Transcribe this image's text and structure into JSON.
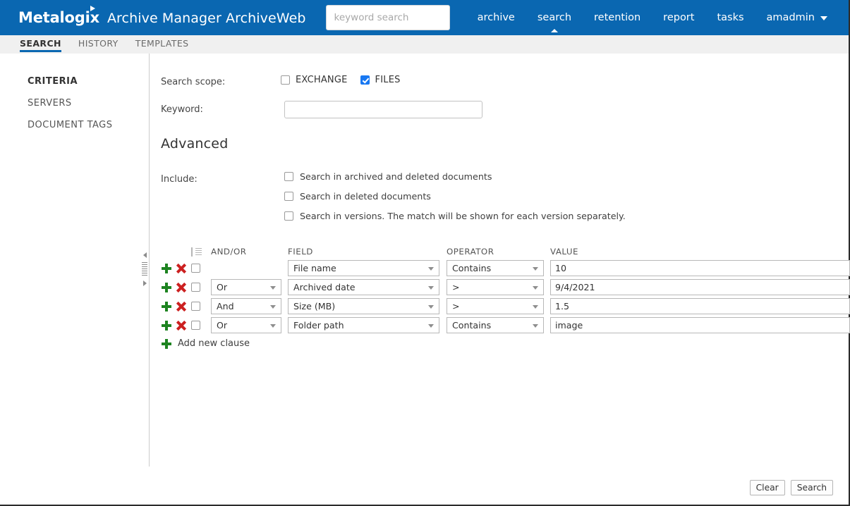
{
  "header": {
    "brand_logo": "Metalogix",
    "app_title": "Archive Manager ArchiveWeb",
    "search_placeholder": "keyword search",
    "search_value": "",
    "nav": [
      {
        "label": "archive",
        "active": false
      },
      {
        "label": "search",
        "active": true
      },
      {
        "label": "retention",
        "active": false
      },
      {
        "label": "report",
        "active": false
      },
      {
        "label": "tasks",
        "active": false
      },
      {
        "label": "amadmin",
        "active": false,
        "has_caret": true
      }
    ]
  },
  "tabs": [
    {
      "label": "SEARCH",
      "active": true
    },
    {
      "label": "HISTORY",
      "active": false
    },
    {
      "label": "TEMPLATES",
      "active": false
    }
  ],
  "sidebar": {
    "items": [
      {
        "label": "CRITERIA",
        "active": true
      },
      {
        "label": "SERVERS",
        "active": false
      },
      {
        "label": "DOCUMENT TAGS",
        "active": false
      }
    ]
  },
  "main": {
    "scope_label": "Search scope:",
    "scope_options": [
      {
        "label": "EXCHANGE",
        "checked": false
      },
      {
        "label": "FILES",
        "checked": true
      }
    ],
    "keyword_label": "Keyword:",
    "keyword_value": "",
    "keyword_placeholder": "",
    "advanced_title": "Advanced",
    "include_label": "Include:",
    "include_options": [
      {
        "label": "Search in archived and deleted documents",
        "checked": false
      },
      {
        "label": "Search in deleted documents",
        "checked": false
      },
      {
        "label": "Search in versions. The match will be shown for each version separately.",
        "checked": false
      }
    ],
    "criteria": {
      "headers": {
        "andor": "AND/OR",
        "field": "FIELD",
        "operator": "OPERATOR",
        "value": "VALUE"
      },
      "rows": [
        {
          "checked": false,
          "andor": "",
          "field": "File name",
          "operator": "Contains",
          "value": "10"
        },
        {
          "checked": false,
          "andor": "Or",
          "field": "Archived date",
          "operator": ">",
          "value": "9/4/2021"
        },
        {
          "checked": false,
          "andor": "And",
          "field": "Size (MB)",
          "operator": ">",
          "value": "1.5"
        },
        {
          "checked": false,
          "andor": "Or",
          "field": "Folder path",
          "operator": "Contains",
          "value": "image"
        }
      ],
      "add_clause_label": "Add new clause"
    }
  },
  "footer": {
    "clear_label": "Clear",
    "search_label": "Search"
  },
  "colors": {
    "brand_blue": "#0a67b1",
    "accent_checkbox": "#1878f2",
    "icon_add_green": "#1d8320",
    "icon_remove_red": "#cc2020",
    "tabstrip_bg": "#f0f0f0"
  }
}
